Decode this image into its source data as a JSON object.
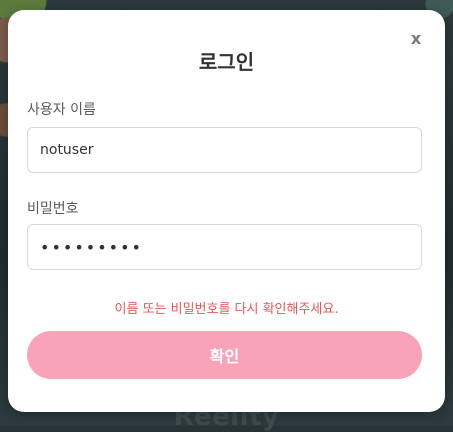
{
  "background": {
    "brand_text": "Reelity"
  },
  "modal": {
    "close_label": "x",
    "title": "로그인",
    "username": {
      "label": "사용자 이름",
      "value": "notuser"
    },
    "password": {
      "label": "비밀번호",
      "value": "•••••••••"
    },
    "error_message": "이름 또는 비밀번호를 다시 확인해주세요.",
    "submit_label": "확인"
  },
  "colors": {
    "accent_button": "#f8a3b8",
    "error_text": "#e05a5a",
    "backdrop": "#243437"
  }
}
